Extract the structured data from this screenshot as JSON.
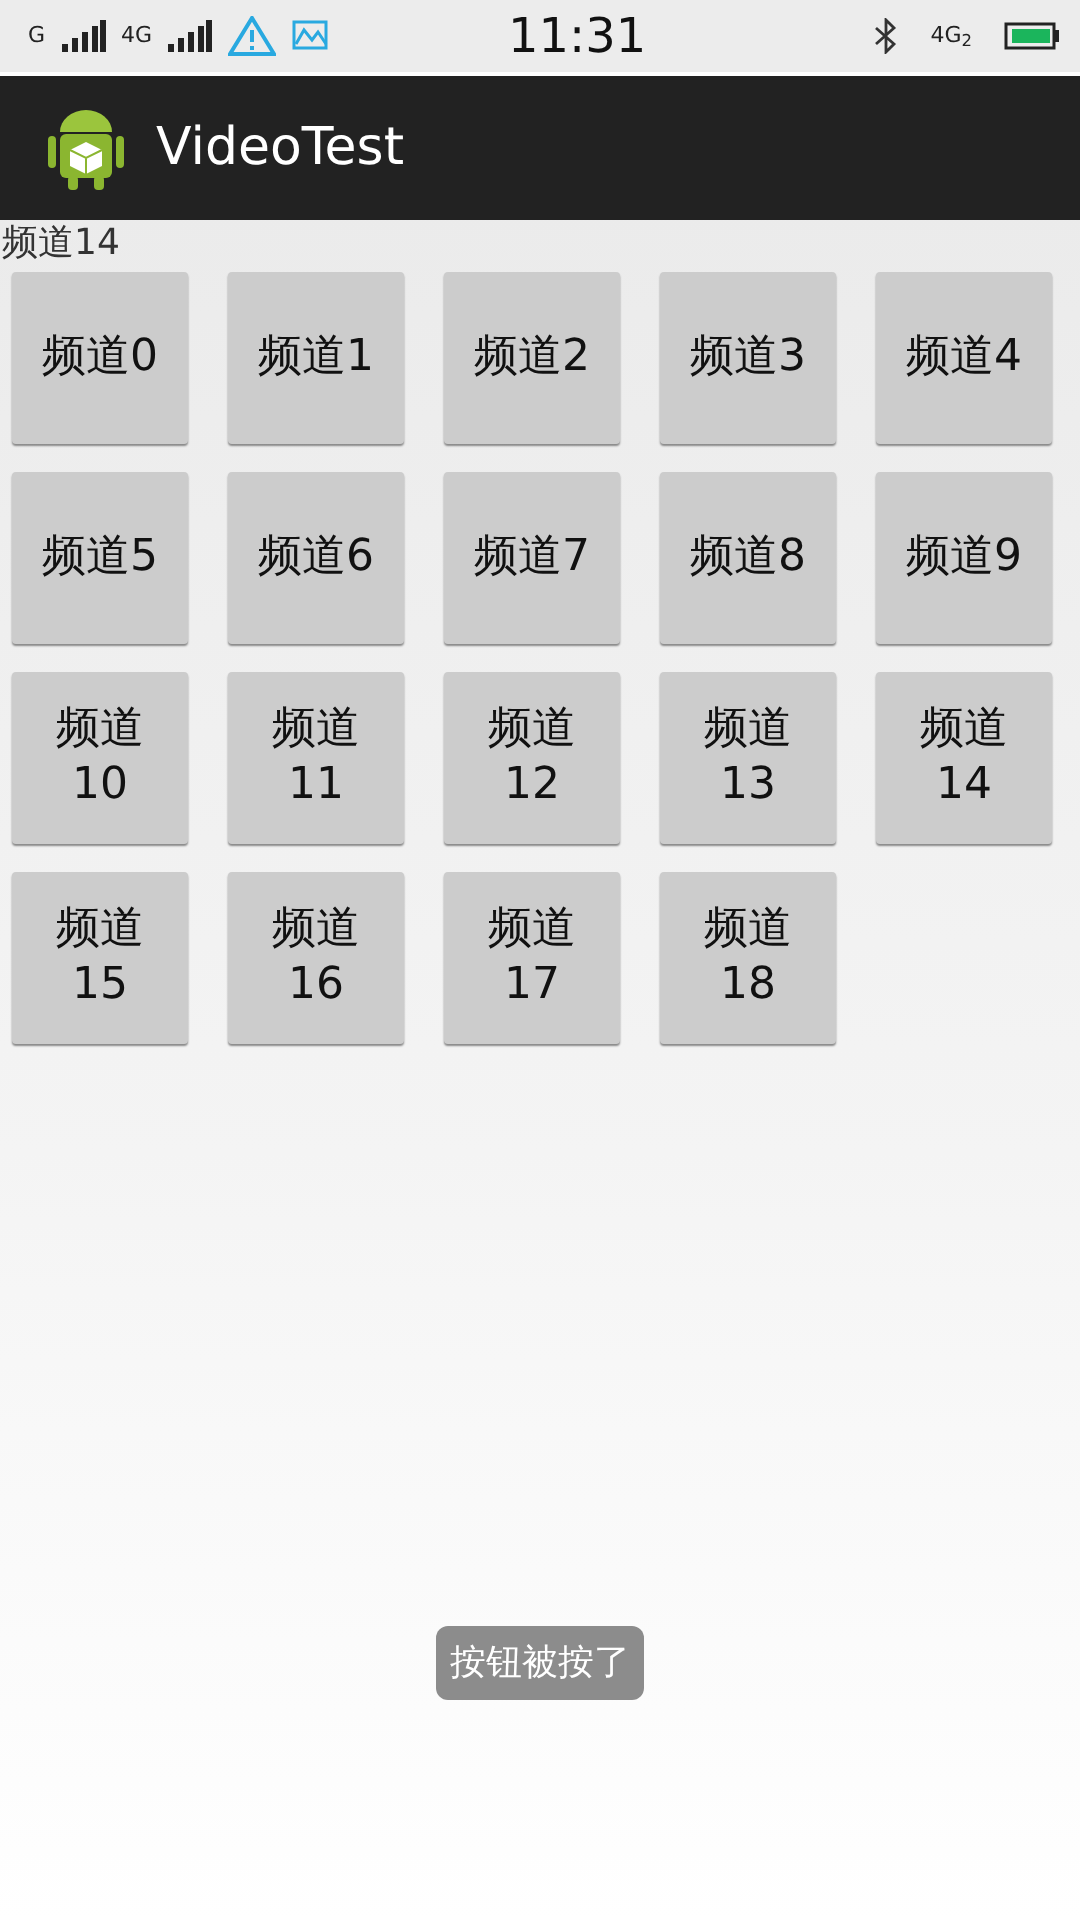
{
  "status_bar": {
    "sim_1": "G",
    "sim_2": "4G",
    "time": "11:31",
    "data_network": "4G$_{2}$"
  },
  "action_bar": {
    "title": "VideoTest"
  },
  "current_channel": "频道14",
  "channels": [
    {
      "label": "频道0"
    },
    {
      "label": "频道1"
    },
    {
      "label": "频道2"
    },
    {
      "label": "频道3"
    },
    {
      "label": "频道4"
    },
    {
      "label": "频道5"
    },
    {
      "label": "频道6"
    },
    {
      "label": "频道7"
    },
    {
      "label": "频道8"
    },
    {
      "label": "频道9"
    },
    {
      "label": "频道10"
    },
    {
      "label": "频道11"
    },
    {
      "label": "频道12"
    },
    {
      "label": "频道13"
    },
    {
      "label": "频道14"
    },
    {
      "label": "频道15"
    },
    {
      "label": "频道16"
    },
    {
      "label": "频道17"
    },
    {
      "label": "频道18"
    }
  ],
  "toast": "按钮被按了"
}
